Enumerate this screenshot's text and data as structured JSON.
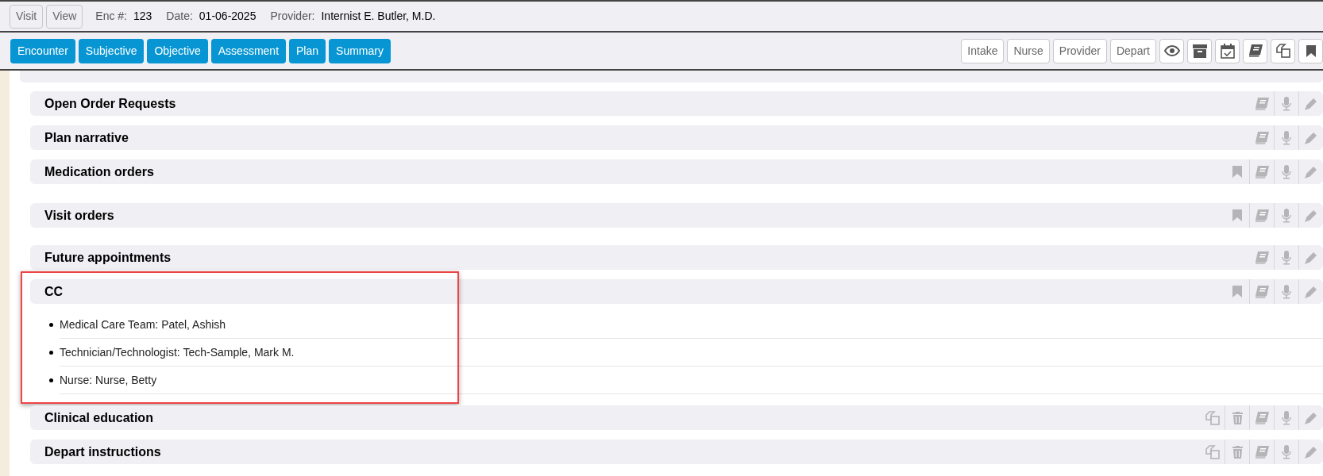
{
  "header": {
    "buttons": [
      "Visit",
      "View"
    ],
    "fields": [
      {
        "label": "Enc #:",
        "value": "123"
      },
      {
        "label": "Date:",
        "value": "01-06-2025"
      },
      {
        "label": "Provider:",
        "value": "Internist E. Butler, M.D."
      }
    ]
  },
  "tabs": [
    "Encounter",
    "Subjective",
    "Objective",
    "Assessment",
    "Plan",
    "Summary"
  ],
  "toolbar": {
    "buttons": [
      "Intake",
      "Nurse",
      "Provider",
      "Depart"
    ],
    "icon_buttons": [
      {
        "kind": "eye"
      },
      {
        "kind": "archive"
      },
      {
        "kind": "calendar"
      },
      {
        "kind": "book"
      },
      {
        "kind": "copy"
      },
      {
        "kind": "bookmark"
      }
    ]
  },
  "sections": [
    {
      "title": "Open Order Requests",
      "highlighted": false,
      "actions": [
        {
          "kind": "book"
        },
        {
          "kind": "mic"
        },
        {
          "kind": "pencil"
        }
      ]
    },
    {
      "title": "Plan narrative",
      "highlighted": false,
      "actions": [
        {
          "kind": "book"
        },
        {
          "kind": "mic"
        },
        {
          "kind": "pencil"
        }
      ]
    },
    {
      "title": "Medication orders",
      "highlighted": false,
      "actions": [
        {
          "kind": "bookmark"
        },
        {
          "kind": "book"
        },
        {
          "kind": "mic"
        },
        {
          "kind": "pencil"
        }
      ]
    },
    {
      "title": "Visit orders",
      "highlighted": false,
      "actions": [
        {
          "kind": "bookmark"
        },
        {
          "kind": "book"
        },
        {
          "kind": "mic"
        },
        {
          "kind": "pencil"
        }
      ]
    },
    {
      "title": "Future appointments",
      "highlighted": false,
      "actions": [
        {
          "kind": "book"
        },
        {
          "kind": "mic"
        },
        {
          "kind": "pencil"
        }
      ]
    },
    {
      "title": "CC",
      "highlighted": true,
      "actions": [
        {
          "kind": "bookmark"
        },
        {
          "kind": "book"
        },
        {
          "kind": "mic"
        },
        {
          "kind": "pencil"
        }
      ],
      "items": [
        "Medical Care Team: Patel, Ashish",
        "Technician/Technologist: Tech-Sample, Mark M.",
        "Nurse: Nurse, Betty"
      ]
    },
    {
      "title": "Clinical education",
      "highlighted": false,
      "actions": [
        {
          "kind": "copy"
        },
        {
          "kind": "trash"
        },
        {
          "kind": "book"
        },
        {
          "kind": "mic"
        },
        {
          "kind": "pencil"
        }
      ]
    },
    {
      "title": "Depart instructions",
      "highlighted": false,
      "actions": [
        {
          "kind": "copy"
        },
        {
          "kind": "trash"
        },
        {
          "kind": "book"
        },
        {
          "kind": "mic"
        },
        {
          "kind": "pencil"
        }
      ]
    }
  ]
}
